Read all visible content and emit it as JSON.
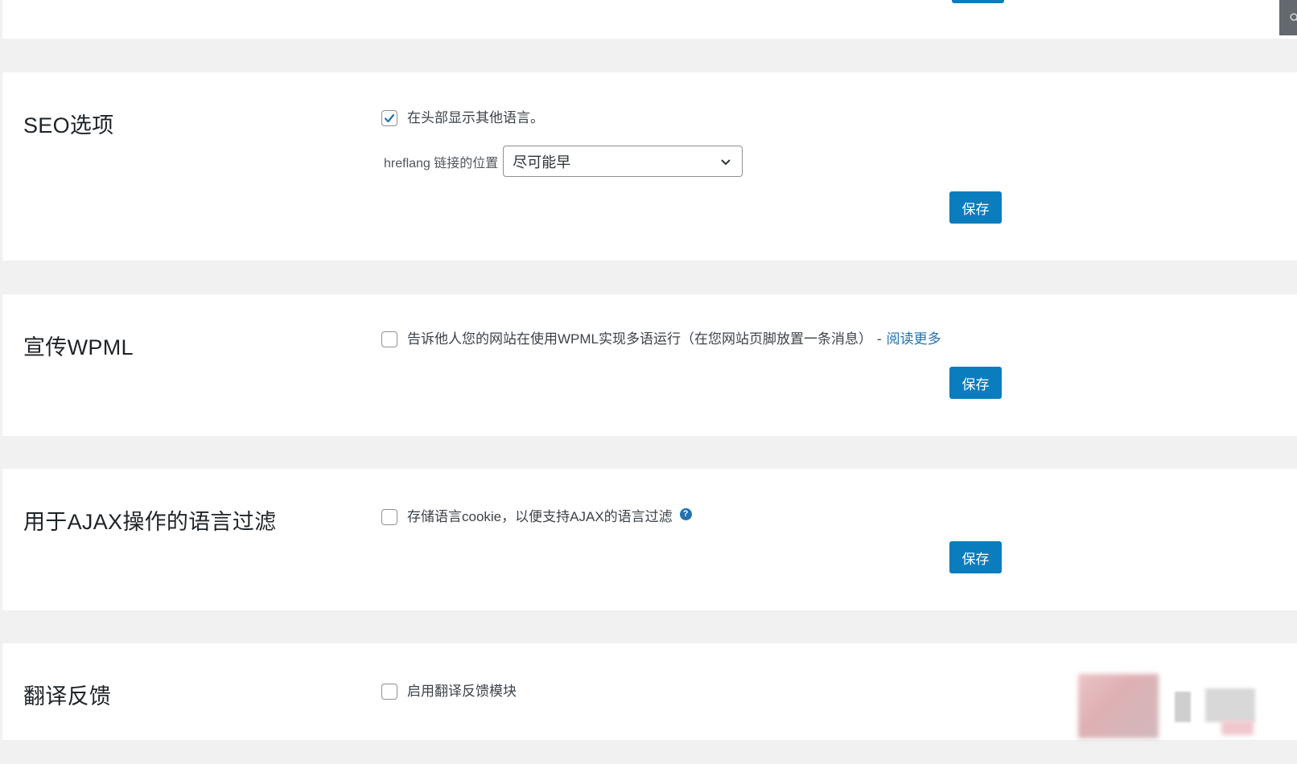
{
  "top_section": {
    "corner_icon": "search-icon"
  },
  "seo": {
    "title": "SEO选项",
    "display_languages_label": "在头部显示其他语言。",
    "display_languages_checked": true,
    "hreflang_label": "hreflang 链接的位置",
    "hreflang_value": "尽可能早",
    "save_label": "保存"
  },
  "promote": {
    "title": "宣传WPML",
    "option_label": "告诉他人您的网站在使用WPML实现多语运行（在您网站页脚放置一条消息）",
    "separator": "-",
    "read_more_label": "阅读更多",
    "checked": false,
    "save_label": "保存"
  },
  "ajax": {
    "title": "用于AJAX操作的语言过滤",
    "option_label": "存储语言cookie，以便支持AJAX的语言过滤",
    "help_icon_text": "?",
    "checked": false,
    "save_label": "保存"
  },
  "feedback": {
    "title": "翻译反馈",
    "option_label": "启用翻译反馈模块",
    "checked": false
  },
  "colors": {
    "button_blue": "#0a7dbf",
    "link_blue": "#2271b1",
    "background": "#f1f1f1",
    "panel": "#ffffff"
  }
}
